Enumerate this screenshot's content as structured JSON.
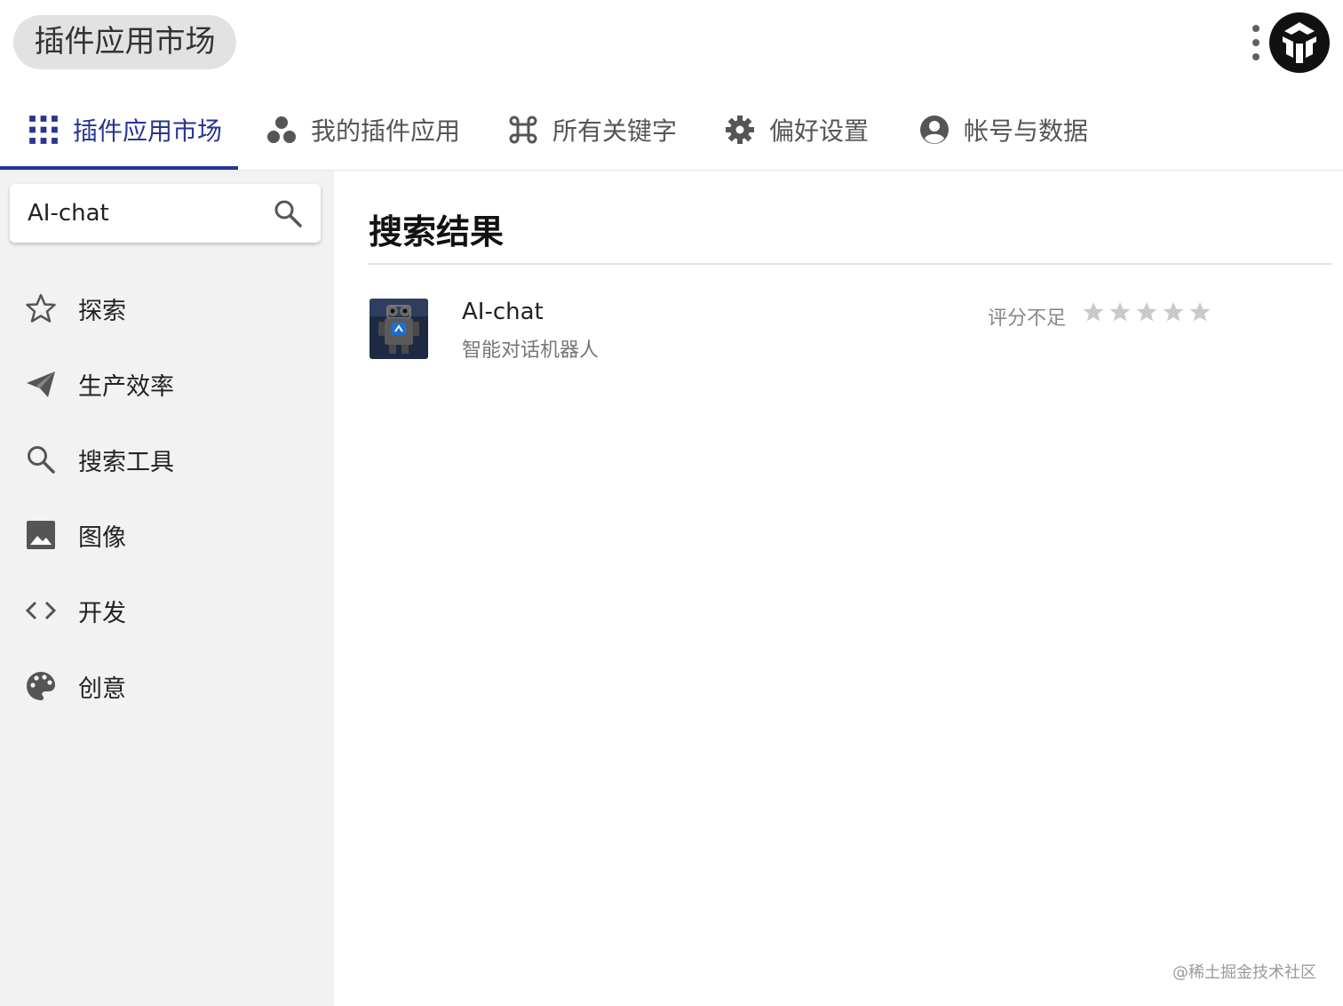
{
  "header": {
    "title": "插件应用市场",
    "more_icon": "more-vertical-icon",
    "avatar_icon": "app-logo-icon"
  },
  "tabs": [
    {
      "label": "插件应用市场",
      "icon": "apps-grid-icon",
      "active": true
    },
    {
      "label": "我的插件应用",
      "icon": "bubbles-icon",
      "active": false
    },
    {
      "label": "所有关键字",
      "icon": "command-icon",
      "active": false
    },
    {
      "label": "偏好设置",
      "icon": "gear-icon",
      "active": false
    },
    {
      "label": "帐号与数据",
      "icon": "account-circle-icon",
      "active": false
    }
  ],
  "search": {
    "value": "AI-chat",
    "icon": "search-icon"
  },
  "sidebar": {
    "items": [
      {
        "label": "探索",
        "icon": "star-outline-icon"
      },
      {
        "label": "生产效率",
        "icon": "send-icon"
      },
      {
        "label": "搜索工具",
        "icon": "search-icon"
      },
      {
        "label": "图像",
        "icon": "image-icon"
      },
      {
        "label": "开发",
        "icon": "code-icon"
      },
      {
        "label": "创意",
        "icon": "palette-icon"
      }
    ]
  },
  "main": {
    "heading": "搜索结果",
    "results": [
      {
        "title": "AI-chat",
        "description": "智能对话机器人",
        "rating_text": "评分不足",
        "stars_filled": 0,
        "stars_total": 5,
        "icon": "robot-icon"
      }
    ]
  },
  "watermark": "@稀土掘金技术社区",
  "colors": {
    "accent": "#283593",
    "sidebar_bg": "#f2f2f2",
    "pill_bg": "#e2e2e2",
    "star_empty": "#c9c9c9"
  }
}
